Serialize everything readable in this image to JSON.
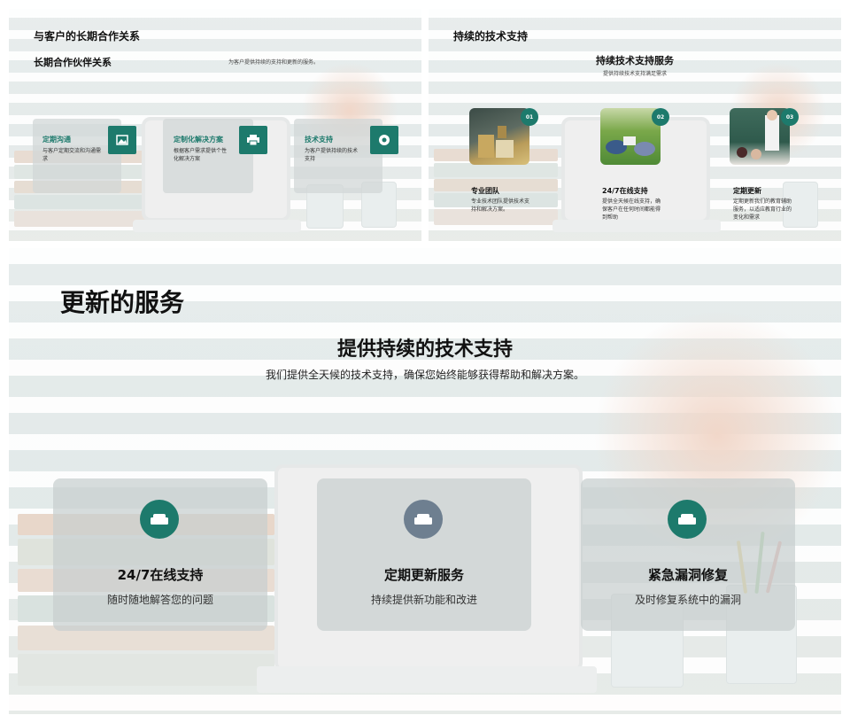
{
  "slide1": {
    "title": "与客户的长期合作关系",
    "subtitle": "长期合作伙伴关系",
    "note": "为客户提供持续的支持和更新的服务。",
    "items": [
      {
        "heading": "定期沟通",
        "desc": "与客户定期交流和沟通需求",
        "icon": "image-icon"
      },
      {
        "heading": "定制化解决方案",
        "desc": "根据客户需求提供个性化解决方案",
        "icon": "printer-icon"
      },
      {
        "heading": "技术支持",
        "desc": "为客户提供持续的技术支持",
        "icon": "lifebuoy-icon"
      }
    ]
  },
  "slide2": {
    "title": "持续的技术支持",
    "subtitle": "持续技术支持服务",
    "note": "提供持续技术支持满足需求",
    "items": [
      {
        "num": "01",
        "heading": "专业团队",
        "desc": "专业技术团队提供技术支持和解决方案。"
      },
      {
        "num": "02",
        "heading": "24/7在线支持",
        "desc": "提供全天候在线支持，确保客户在任何时间都能得到帮助"
      },
      {
        "num": "03",
        "heading": "定期更新",
        "desc": "定期更新我们的教育辅助服务，以适应教育行业的变化和需求"
      }
    ]
  },
  "slide3": {
    "title": "更新的服务",
    "headline": "提供持续的技术支持",
    "subline": "我们提供全天候的技术支持，确保您始终能够获得帮助和解决方案。",
    "cards": [
      {
        "heading": "24/7在线支持",
        "desc": "随时随地解答您的问题",
        "icon": "sofa-icon",
        "color": "#1d7a6c"
      },
      {
        "heading": "定期更新服务",
        "desc": "持续提供新功能和改进",
        "icon": "sofa-icon",
        "color": "#6e7f90"
      },
      {
        "heading": "紧急漏洞修复",
        "desc": "及时修复系统中的漏洞",
        "icon": "sofa-icon",
        "color": "#1d7a6c"
      }
    ]
  },
  "colors": {
    "accent": "#1d7a6c",
    "accent_alt": "#6e7f90"
  }
}
